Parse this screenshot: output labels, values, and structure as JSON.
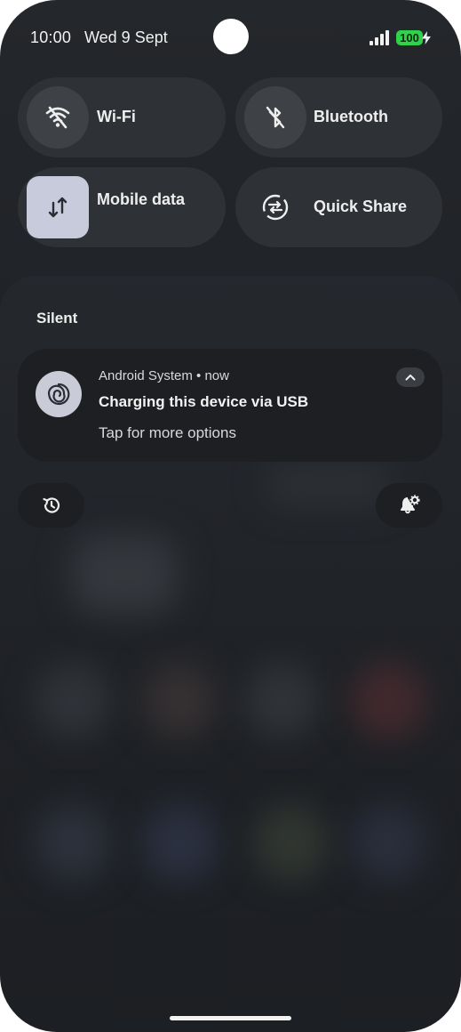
{
  "status_bar": {
    "time": "10:00",
    "date": "Wed 9 Sept",
    "battery_level": "100",
    "battery_color": "#2fd24a",
    "signal_icon": "signal-icon",
    "charging_icon": "bolt-icon"
  },
  "quick_tiles": [
    {
      "label": "Wi-Fi",
      "icon": "wifi-off-icon",
      "active": false
    },
    {
      "label": "Bluetooth",
      "icon": "bluetooth-off-icon",
      "active": false
    },
    {
      "label": "Mobile data",
      "icon": "mobile-data-icon",
      "active": true
    },
    {
      "label": "Quick Share",
      "icon": "quick-share-icon",
      "active": false
    }
  ],
  "notifications": {
    "section_title": "Silent",
    "items": [
      {
        "app": "Android System • now",
        "title": "Charging this device via USB",
        "text": "Tap for more options",
        "icon": "android-system-icon"
      }
    ]
  },
  "actions": {
    "history_icon": "history-icon",
    "settings_icon": "notification-settings-icon"
  },
  "accent_colors": {
    "active_tile": "#c7cbdc",
    "tile_bg": "#2e3136"
  }
}
